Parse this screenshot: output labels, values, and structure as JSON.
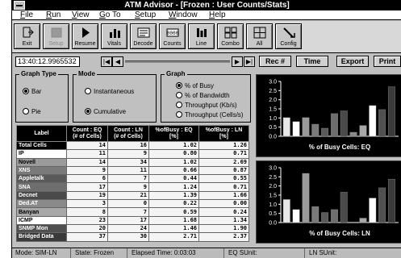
{
  "window": {
    "title": "ATM Advisor - [Frozen : User Counts/Stats]"
  },
  "menu": [
    "File",
    "Run",
    "View",
    "Go To",
    "Setup",
    "Window",
    "Help"
  ],
  "toolbar": [
    {
      "label": "Exit",
      "icon": "exit-icon",
      "enabled": true
    },
    {
      "label": "Setup",
      "icon": "setup-icon",
      "enabled": false
    },
    {
      "label": "Resume",
      "icon": "play-icon",
      "enabled": true
    },
    {
      "label": "Vitals",
      "icon": "vitals-icon",
      "enabled": true
    },
    {
      "label": "Decode",
      "icon": "decode-icon",
      "enabled": true
    },
    {
      "label": "Counts",
      "icon": "counts-icon",
      "enabled": true
    },
    {
      "label": "Line",
      "icon": "line-icon",
      "enabled": true
    },
    {
      "label": "Combo",
      "icon": "combo-icon",
      "enabled": true
    },
    {
      "label": "All",
      "icon": "all-icon",
      "enabled": true
    },
    {
      "label": "Config",
      "icon": "config-icon",
      "enabled": true
    }
  ],
  "controls": {
    "time": "13:40:12.9965532",
    "buttons": [
      "Rec #",
      "Time",
      "Export",
      "Print"
    ]
  },
  "graph_type": {
    "label": "Graph Type",
    "options": [
      "Bar",
      "Pie"
    ],
    "selected": "Bar"
  },
  "mode": {
    "label": "Mode",
    "options": [
      "Instantaneous",
      "Cumulative"
    ],
    "selected": "Cumulative"
  },
  "graph": {
    "label": "Graph",
    "options": [
      "% of Busy",
      "% of Bandwidth",
      "Throughput (Kb/s)",
      "Throughput (Cells/s)"
    ],
    "selected": "% of Busy"
  },
  "table": {
    "headers": [
      "Label",
      "Count : EQ\n(# of Cells)",
      "Count : LN\n(# of Cells)",
      "%ofBusy : EQ\n[%]",
      "%ofBusy : LN\n[%]"
    ],
    "rows": [
      {
        "label": "Total Cells",
        "color": "#000000",
        "cells": [
          "14",
          "16",
          "1.02",
          "1.26"
        ]
      },
      {
        "label": "IP",
        "color": "#ffffff",
        "cells": [
          "11",
          "9",
          "0.80",
          "0.71"
        ]
      },
      {
        "label": "Novell",
        "color": "#9a9a9a",
        "cells": [
          "14",
          "34",
          "1.02",
          "2.69"
        ]
      },
      {
        "label": "XNS",
        "color": "#7a7a7a",
        "cells": [
          "9",
          "11",
          "0.66",
          "0.87"
        ]
      },
      {
        "label": "Appletalk",
        "color": "#5a5a5a",
        "cells": [
          "6",
          "7",
          "0.44",
          "0.55"
        ]
      },
      {
        "label": "SNA",
        "color": "#6e6e6e",
        "cells": [
          "17",
          "9",
          "1.24",
          "0.71"
        ]
      },
      {
        "label": "Decnet",
        "color": "#4a4a4a",
        "cells": [
          "19",
          "21",
          "1.39",
          "1.66"
        ]
      },
      {
        "label": "Ded.AT",
        "color": "#8a8a8a",
        "cells": [
          "3",
          "0",
          "0.22",
          "0.00"
        ]
      },
      {
        "label": "Banyan",
        "color": "#a8a8a8",
        "cells": [
          "8",
          "7",
          "0.59",
          "0.24"
        ]
      },
      {
        "label": "ICMP",
        "color": "#ffffff",
        "cells": [
          "23",
          "17",
          "1.68",
          "1.34"
        ]
      },
      {
        "label": "SNMP Mon",
        "color": "#505050",
        "cells": [
          "20",
          "24",
          "1.46",
          "1.90"
        ]
      },
      {
        "label": "Bridged Data",
        "color": "#3a3a3a",
        "cells": [
          "37",
          "30",
          "2.71",
          "2.37"
        ]
      }
    ]
  },
  "chart_data": [
    {
      "type": "bar",
      "title": "% of Busy Cells: EQ",
      "ylim": [
        0,
        3.0
      ],
      "yticks": [
        "3.0",
        "2.5",
        "2.0",
        "1.5",
        "1.0",
        "0.5",
        "0.0"
      ],
      "categories": [
        "Total Cells",
        "IP",
        "Novell",
        "XNS",
        "Appletalk",
        "SNA",
        "Decnet",
        "Ded.AT",
        "Banyan",
        "ICMP",
        "SNMP Mon",
        "Bridged Data"
      ],
      "values": [
        1.02,
        0.8,
        1.02,
        0.66,
        0.44,
        1.24,
        1.39,
        0.22,
        0.59,
        1.68,
        1.46,
        2.71
      ]
    },
    {
      "type": "bar",
      "title": "% of Busy Cells: LN",
      "ylim": [
        0,
        3.0
      ],
      "yticks": [
        "3.0",
        "2.5",
        "2.0",
        "1.5",
        "1.0",
        "0.5",
        "0.0"
      ],
      "categories": [
        "Total Cells",
        "IP",
        "Novell",
        "XNS",
        "Appletalk",
        "SNA",
        "Decnet",
        "Ded.AT",
        "Banyan",
        "ICMP",
        "SNMP Mon",
        "Bridged Data"
      ],
      "values": [
        1.26,
        0.71,
        2.69,
        0.87,
        0.55,
        0.71,
        1.66,
        0.0,
        0.24,
        1.34,
        1.9,
        2.37
      ]
    }
  ],
  "status": {
    "mode": "Mode: SIM-LN",
    "state": "State: Frozen",
    "elapsed": "Elapsed Time: 0:03:03",
    "eq": "EQ SUnit:",
    "ln": "LN SUnit:"
  }
}
